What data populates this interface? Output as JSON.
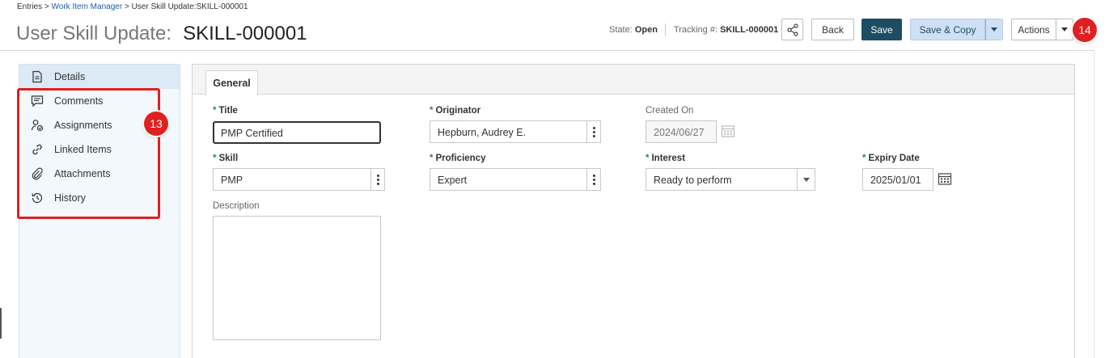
{
  "breadcrumb": {
    "root": "Entries",
    "link": "Work Item Manager",
    "current": "User Skill Update:SKILL-000001",
    "sep": ">"
  },
  "title": {
    "prefix": "User Skill Update:",
    "id": "SKILL-000001"
  },
  "status": {
    "state_label": "State:",
    "state_value": "Open",
    "tracking_label": "Tracking #:",
    "tracking_value": "SKILL-000001"
  },
  "toolbar": {
    "back": "Back",
    "save": "Save",
    "save_copy": "Save & Copy",
    "actions": "Actions"
  },
  "badges": {
    "actions": "14",
    "sidebar": "13"
  },
  "sidebar": {
    "items": [
      {
        "label": "Details",
        "icon": "document-icon",
        "active": true
      },
      {
        "label": "Comments",
        "icon": "comment-icon"
      },
      {
        "label": "Assignments",
        "icon": "assignment-icon"
      },
      {
        "label": "Linked Items",
        "icon": "link-icon"
      },
      {
        "label": "Attachments",
        "icon": "paperclip-icon"
      },
      {
        "label": "History",
        "icon": "history-icon"
      }
    ]
  },
  "tabs": [
    {
      "label": "General",
      "active": true
    }
  ],
  "form": {
    "title": {
      "label": "Title",
      "value": "PMP Certified"
    },
    "originator": {
      "label": "Originator",
      "value": "Hepburn, Audrey E."
    },
    "created_on": {
      "label": "Created On",
      "value": "2024/06/27"
    },
    "skill": {
      "label": "Skill",
      "value": "PMP"
    },
    "proficiency": {
      "label": "Proficiency",
      "value": "Expert"
    },
    "interest": {
      "label": "Interest",
      "value": "Ready to perform"
    },
    "expiry_date": {
      "label": "Expiry Date",
      "value": "2025/01/01"
    },
    "description": {
      "label": "Description",
      "value": ""
    }
  },
  "colors": {
    "primary": "#1d4d62",
    "secondary": "#cfe0f5",
    "highlight": "#e02020",
    "required": "#2e8b57"
  }
}
